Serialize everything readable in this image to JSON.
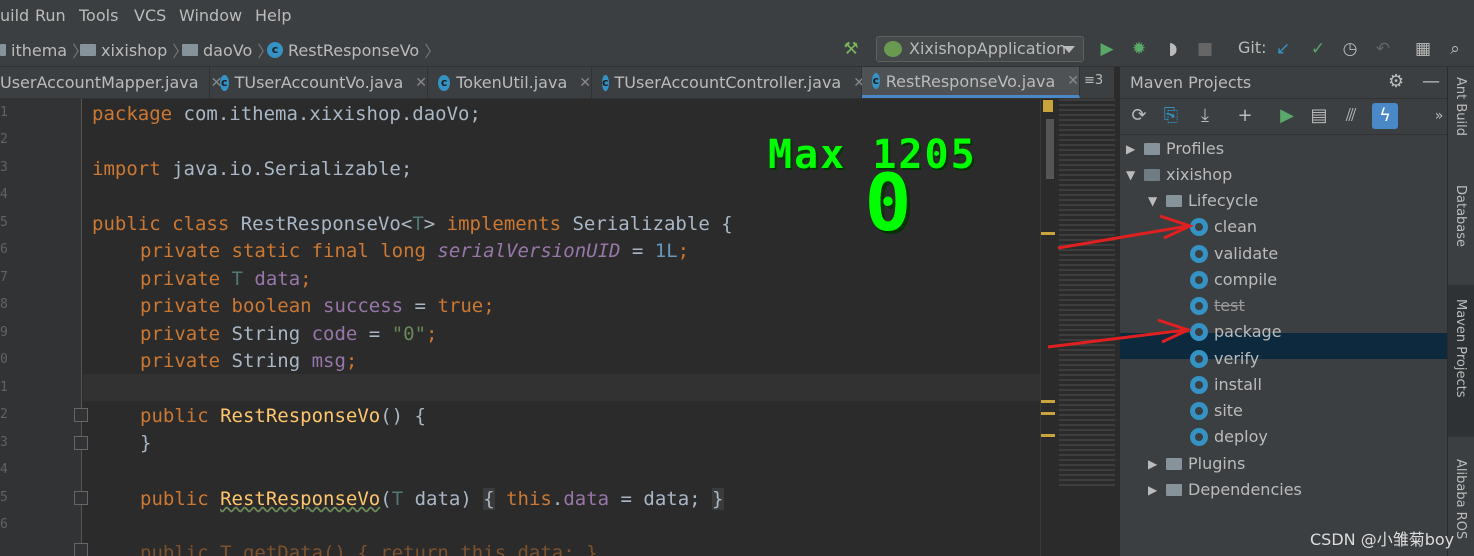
{
  "menu": [
    "uild",
    "Run",
    "Tools",
    "VCS",
    "Window",
    "Help"
  ],
  "breadcrumb": [
    "ithema",
    "xixishop",
    "daoVo",
    "RestResponseVo"
  ],
  "run_config": "XixishopApplication",
  "git_label": "Git:",
  "tabs": [
    {
      "label": "UserAccountMapper.java",
      "active": false
    },
    {
      "label": "TUserAccountVo.java",
      "active": false
    },
    {
      "label": "TokenUtil.java",
      "active": false
    },
    {
      "label": "TUserAccountController.java",
      "active": false
    },
    {
      "label": "RestResponseVo.java",
      "active": true
    }
  ],
  "tab_overflow": "≡3",
  "line_numbers": [
    "1",
    "2",
    "3",
    "4",
    "5",
    "6",
    "7",
    "8",
    "9",
    "0",
    "1",
    "2",
    "3",
    "4",
    "5",
    "6"
  ],
  "code": {
    "l1_kw": "package",
    "l1_rest": " com.ithema.xixishop.daoVo;",
    "l3_kw": "import",
    "l3_rest": " java.io.Serializable;",
    "l5_kw1": "public class",
    "l5_name": " RestResponseVo<",
    "l5_t": "T",
    "l5_gt": "> ",
    "l5_kw2": "implements",
    "l5_rest": " Serializable {",
    "l6_kw": "private static final long ",
    "l6_field": "serialVersionUID",
    "l6_eq": " = ",
    "l6_num": "1L",
    "l6_end": ";",
    "l7_kw": "private ",
    "l7_t": "T ",
    "l7_field": "data",
    "l7_end": ";",
    "l8_kw": "private boolean ",
    "l8_field": "success",
    "l8_eq": " = ",
    "l8_val": "true",
    "l8_end": ";",
    "l9_kw": "private ",
    "l9_type": "String ",
    "l9_field": "code",
    "l9_eq": " = ",
    "l9_str": "\"0\"",
    "l9_end": ";",
    "l10_kw": "private ",
    "l10_type": "String ",
    "l10_field": "msg",
    "l10_end": ";",
    "l12_kw": "public ",
    "l12_m": "RestResponseVo",
    "l12_rest": "() {",
    "l13": "}",
    "l15_kw": "public ",
    "l15_m": "RestResponseVo",
    "l15_p": "(",
    "l15_t": "T",
    "l15_param": " data) ",
    "l15_b1": "{",
    "l15_this": " this",
    "l15_dot": ".",
    "l15_field": "data",
    "l15_assign": " = data; ",
    "l15_b2": "}",
    "l17": "public T getData() { return this.data; }"
  },
  "overlay": {
    "max_label": "Max 1205",
    "value": "0"
  },
  "maven": {
    "title": "Maven Projects",
    "tree": {
      "profiles": "Profiles",
      "project": "xixishop",
      "lifecycle": "Lifecycle",
      "phases": [
        "clean",
        "validate",
        "compile",
        "test",
        "package",
        "verify",
        "install",
        "site",
        "deploy"
      ],
      "selected": "package",
      "plugins": "Plugins",
      "dependencies": "Dependencies"
    }
  },
  "side_tabs": [
    "Ant Build",
    "Database",
    "Maven Projects",
    "Alibaba ROS"
  ],
  "watermark": "CSDN @小雏菊boy",
  "colors": {
    "accent": "#4a88c7",
    "selection": "#0d293e",
    "arrow": "#e02020",
    "overlay": "#00ff00"
  }
}
